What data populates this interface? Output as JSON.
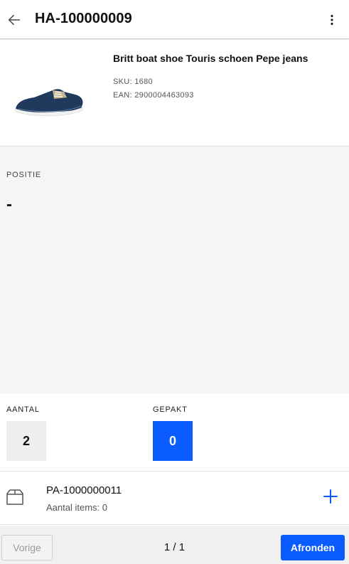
{
  "header": {
    "title": "HA-100000009",
    "back_icon": "arrow-left-icon",
    "menu_icon": "more-vertical-icon"
  },
  "product": {
    "name": "Britt boat shoe Touris schoen Pepe jeans",
    "sku": "SKU: 1680",
    "ean": "EAN: 2900004463093",
    "image_icon": "shoe-image"
  },
  "position": {
    "label": "POSITIE",
    "value": "-"
  },
  "counts": {
    "aantal_label": "AANTAL",
    "aantal_value": "2",
    "gepakt_label": "GEPAKT",
    "gepakt_value": "0"
  },
  "package": {
    "icon": "box-icon",
    "name": "PA-1000000011",
    "items": "Aantal items: 0",
    "add_icon": "plus-icon"
  },
  "footer": {
    "prev_label": "Vorige",
    "page_indicator": "1 / 1",
    "finish_label": "Afronden"
  },
  "colors": {
    "accent": "#0a5cff",
    "position_bg": "#f5f5f5",
    "footer_bg": "#f0f0f0"
  }
}
